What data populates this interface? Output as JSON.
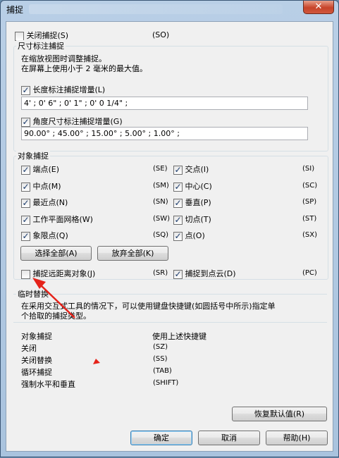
{
  "window": {
    "title": "捕捉",
    "close": "✕"
  },
  "close_snap": {
    "label": "关闭捕捉(S)",
    "code": "(SO)",
    "checked": false
  },
  "dimension": {
    "title": "尺寸标注捕捉",
    "desc1": "在缩放视图时调整捕捉。",
    "desc2": "在屏幕上使用小于 2 毫米的最大值。",
    "length_label": "长度标注捕捉增量(L)",
    "length_value": "4' ; 0' 6\" ; 0' 1\" ; 0' 0 1/4\" ;",
    "angle_label": "角度尺寸标注捕捉增量(G)",
    "angle_value": "90.00° ; 45.00° ; 15.00° ; 5.00° ; 1.00° ;"
  },
  "osnap": {
    "title": "对象捕捉",
    "left": [
      {
        "label": "端点(E)",
        "code": "(SE)"
      },
      {
        "label": "中点(M)",
        "code": "(SM)"
      },
      {
        "label": "最近点(N)",
        "code": "(SN)"
      },
      {
        "label": "工作平面网格(W)",
        "code": "(SW)"
      },
      {
        "label": "象限点(Q)",
        "code": "(SQ)"
      }
    ],
    "right": [
      {
        "label": "交点(I)",
        "code": "(SI)"
      },
      {
        "label": "中心(C)",
        "code": "(SC)"
      },
      {
        "label": "垂直(P)",
        "code": "(SP)"
      },
      {
        "label": "切点(T)",
        "code": "(ST)"
      },
      {
        "label": "点(O)",
        "code": "(SX)"
      }
    ],
    "select_all": "选择全部(A)",
    "clear_all": "放弃全部(K)",
    "remote_label": "捕捉远距离对象(J)",
    "remote_code": "(SR)",
    "cloud_label": "捕捉到点云(D)",
    "cloud_code": "(PC)"
  },
  "override": {
    "title": "临时替换",
    "desc1": "在采用交互式工具的情况下，可以使用键盘快捷键(如圆括号中所示)指定单",
    "desc2": "个拾取的捕捉类型。",
    "header_left": "对象捕捉",
    "header_right": "使用上述快捷键",
    "rows": [
      {
        "name": "关闭",
        "key": "(SZ)"
      },
      {
        "name": "关闭替换",
        "key": "(SS)"
      },
      {
        "name": "循环捕捉",
        "key": "(TAB)"
      },
      {
        "name": "强制水平和垂直",
        "key": "(SHIFT)"
      }
    ]
  },
  "buttons": {
    "restore": "恢复默认值(R)",
    "ok": "确定",
    "cancel": "取消",
    "help": "帮助(H)"
  },
  "colors": {
    "arrow": "#e5231a"
  }
}
